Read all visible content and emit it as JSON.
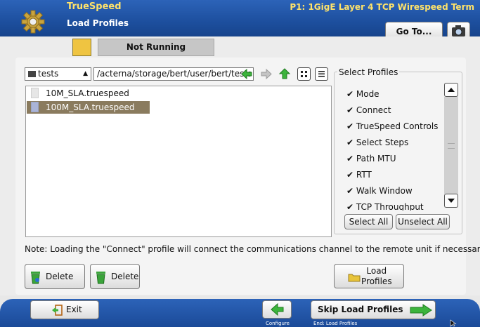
{
  "header": {
    "app_title": "TrueSpeed",
    "page_title": "Load Profiles",
    "port_title": "P1: 1GigE Layer 4 TCP Wirespeed Term",
    "goto_label": "Go To..."
  },
  "status": {
    "text": "Not Running",
    "led_color": "#efc441"
  },
  "browser": {
    "folder": "tests",
    "path": "/acterna/storage/bert/user/bert/tests",
    "files": [
      {
        "name": "10M_SLA.truespeed",
        "selected": false
      },
      {
        "name": "100M_SLA.truespeed",
        "selected": true
      }
    ]
  },
  "select_profiles": {
    "legend": "Select Profiles",
    "items": [
      "✔ Mode",
      "✔ Connect",
      "✔ TrueSpeed Controls",
      "✔ Select Steps",
      "✔ Path MTU",
      "✔ RTT",
      "✔ Walk Window",
      "✔ TCP Throughput"
    ],
    "select_all": "Select All",
    "unselect_all": "Unselect All"
  },
  "note": "Note: Loading the \"Connect\" profile will connect the communications channel to the remote unit if necessary.",
  "actions": {
    "delete_all": "Delete All",
    "delete": "Delete",
    "load_line1": "Load",
    "load_line2": "Profiles"
  },
  "footer": {
    "exit": "Exit",
    "back_caption": "Configure",
    "skip": "Skip Load Profiles",
    "skip_caption": "End: Load Profiles"
  },
  "colors": {
    "header_blue": "#1d4f9e",
    "accent_yellow": "#ffe36a",
    "nav_green": "#3cb43c",
    "selection": "#8a7b5e"
  },
  "icons": [
    "gear-icon",
    "camera-icon",
    "folder-icon",
    "back-arrow-icon",
    "forward-arrow-icon",
    "up-arrow-icon",
    "grid-view-icon",
    "list-view-icon",
    "file-icon",
    "trash-icon",
    "load-folder-icon",
    "exit-icon",
    "cursor-icon"
  ]
}
